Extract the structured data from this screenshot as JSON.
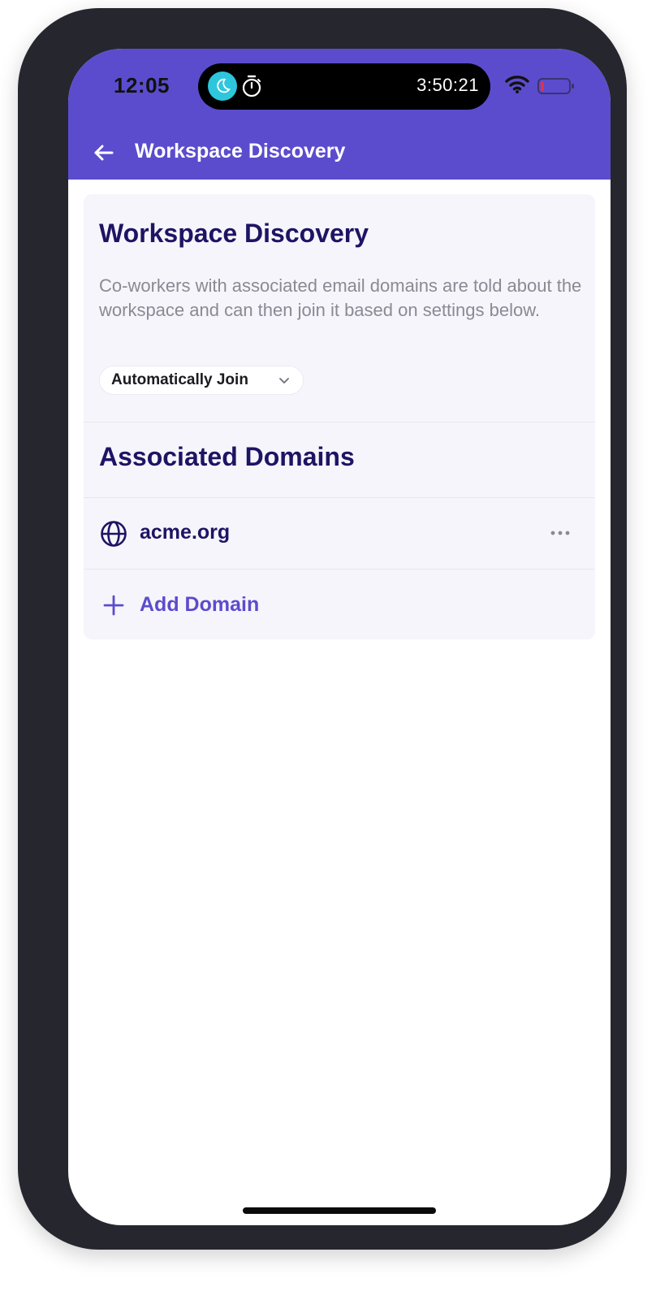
{
  "status_bar": {
    "time": "12:05",
    "timer": "3:50:21",
    "accent": "#5b4ccd",
    "moon_badge_color": "#2ec6dc",
    "battery_color": "#e0304a",
    "icons": [
      "moon-icon",
      "timer-icon",
      "wifi-icon",
      "battery-icon"
    ]
  },
  "header": {
    "title": "Workspace Discovery",
    "back_icon": "arrow-left-icon"
  },
  "discovery": {
    "title": "Workspace Discovery",
    "description": "Co-workers with associated email domains are told about the workspace and can then join it based on settings below.",
    "join_mode_selected": "Automatically Join"
  },
  "domains": {
    "title": "Associated Domains",
    "items": [
      {
        "name": "acme.org",
        "icon": "globe-icon",
        "menu_icon": "more-icon"
      }
    ],
    "add_label": "Add Domain",
    "add_icon": "plus-icon"
  },
  "colors": {
    "primary": "#5b4ccd",
    "heading": "#1d1464",
    "muted": "#8a8a95",
    "card_bg": "#f6f5fb"
  }
}
